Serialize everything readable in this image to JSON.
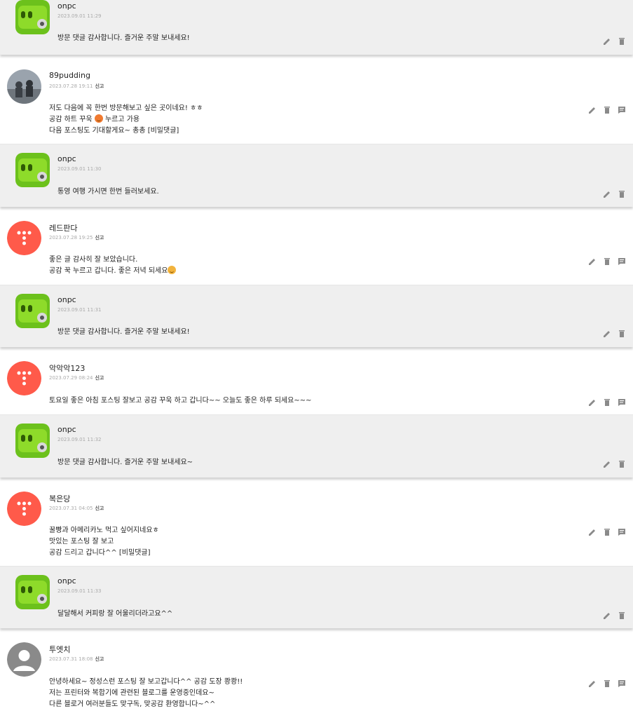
{
  "threads": [
    {
      "type": "reply",
      "avatar": "green-robot-avatar",
      "name": "onpc",
      "date": "2023.09.01 11:29",
      "lines": [
        "방문 댓글 감사합니다. 즐거운 주말 보내세요!"
      ]
    },
    {
      "type": "comment",
      "avatar": "photo-avatar",
      "name": "89pudding",
      "date": "2023.07.28 19:11",
      "report": "신고",
      "lines": [
        "저도 다음에 꼭 한번 방문해보고 싶은 곳이네요! ㅎㅎ",
        "공감 하트 꾸욱",
        "누르고 가용",
        "다음 포스팅도 기대할게요~ 총총 [비밀댓글]"
      ]
    },
    {
      "type": "reply",
      "avatar": "green-robot-avatar",
      "name": "onpc",
      "date": "2023.09.01 11:30",
      "lines": [
        "통영 여행 가시면 한번 들러보세요."
      ]
    },
    {
      "type": "comment",
      "avatar": "tistory-avatar",
      "name": "레드판다",
      "date": "2023.07.28 19:25",
      "report": "신고",
      "lines": [
        "좋은 글 감사히 잘 보았습니다.",
        "공감 꾹 누르고 갑니다. 좋은 저녁 되세요"
      ]
    },
    {
      "type": "reply",
      "avatar": "green-robot-avatar",
      "name": "onpc",
      "date": "2023.09.01 11:31",
      "lines": [
        "방문 댓글 감사합니다. 즐거운 주말 보내세요!"
      ]
    },
    {
      "type": "comment",
      "avatar": "tistory-avatar",
      "name": "악악악123",
      "date": "2023.07.29 08:24",
      "report": "신고",
      "lines": [
        "토요일 좋은 아침 포스팅 잘보고 공감 꾸욱 하고 갑니다~~ 오늘도 좋은 하루 되세요~~~"
      ]
    },
    {
      "type": "reply",
      "avatar": "green-robot-avatar",
      "name": "onpc",
      "date": "2023.09.01 11:32",
      "lines": [
        "방문 댓글 감사합니다. 즐거운 주말 보내세요~"
      ]
    },
    {
      "type": "comment",
      "avatar": "tistory-avatar",
      "name": "복은당",
      "date": "2023.07.31 04:05",
      "report": "신고",
      "lines": [
        "꿀빵과 아메리카노 먹고 싶어지네요ㅎ",
        "맛있는 포스팅 잘 보고",
        "공감 드리고 갑니다^^ [비밀댓글]"
      ]
    },
    {
      "type": "reply",
      "avatar": "green-robot-avatar",
      "name": "onpc",
      "date": "2023.09.01 11:33",
      "lines": [
        "달달해서 커피랑 잘 어울리더라고요^^"
      ]
    },
    {
      "type": "comment",
      "avatar": "default-avatar",
      "name": "투엣치",
      "date": "2023.07.31 18:08",
      "report": "신고",
      "lines": [
        "안녕하세요~ 정성스런 포스팅 잘 보고갑니다^^ 공감 도장 쾅쾅!!",
        "저는 프린터와 복합기에 관련된 블로그를 운영중인데요~",
        "다른 블로거 여러분들도 맞구독, 맞공감 환영합니다~^^"
      ]
    }
  ]
}
